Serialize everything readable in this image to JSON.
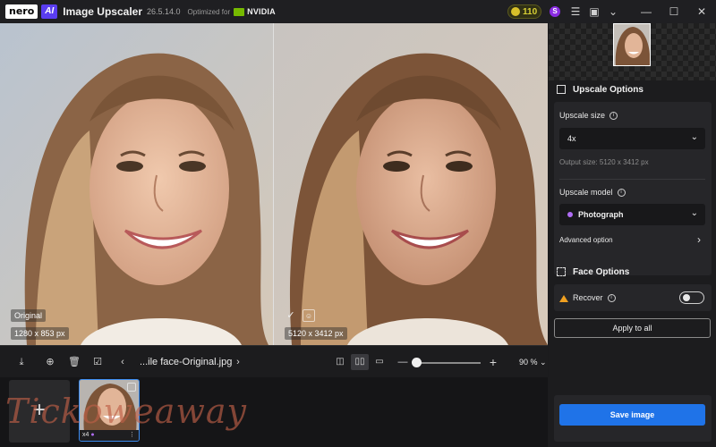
{
  "titlebar": {
    "logo": "nero",
    "ai_badge": "AI",
    "app_name": "Image Upscaler",
    "version": "26.5.14.0",
    "optimized_for": "Optimized for",
    "nvidia": "NVIDIA",
    "credits": "110",
    "avatar_initial": "S"
  },
  "compare": {
    "left_label": "Original",
    "left_size": "1280 x 853 px",
    "right_size": "5120 x 3412 px"
  },
  "panel": {
    "upscale_options_title": "Upscale Options",
    "upscale_size_label": "Upscale size",
    "upscale_size_value": "4x",
    "output_size": "Output size: 5120 x 3412 px",
    "upscale_model_label": "Upscale model",
    "upscale_model_value": "Photograph",
    "model_color": "#b06df5",
    "advanced_option": "Advanced option",
    "face_options_title": "Face Options",
    "recover_label": "Recover",
    "recover_enabled": false,
    "apply_all": "Apply to all",
    "save_image": "Save image"
  },
  "toolbar": {
    "filename": "...ile face-Original.jpg",
    "zoom": "90 %",
    "zoom_level_fraction": 0.05
  },
  "filmstrip": {
    "add": "+",
    "item_scale": "x4"
  },
  "watermark": "Tickoweaway"
}
